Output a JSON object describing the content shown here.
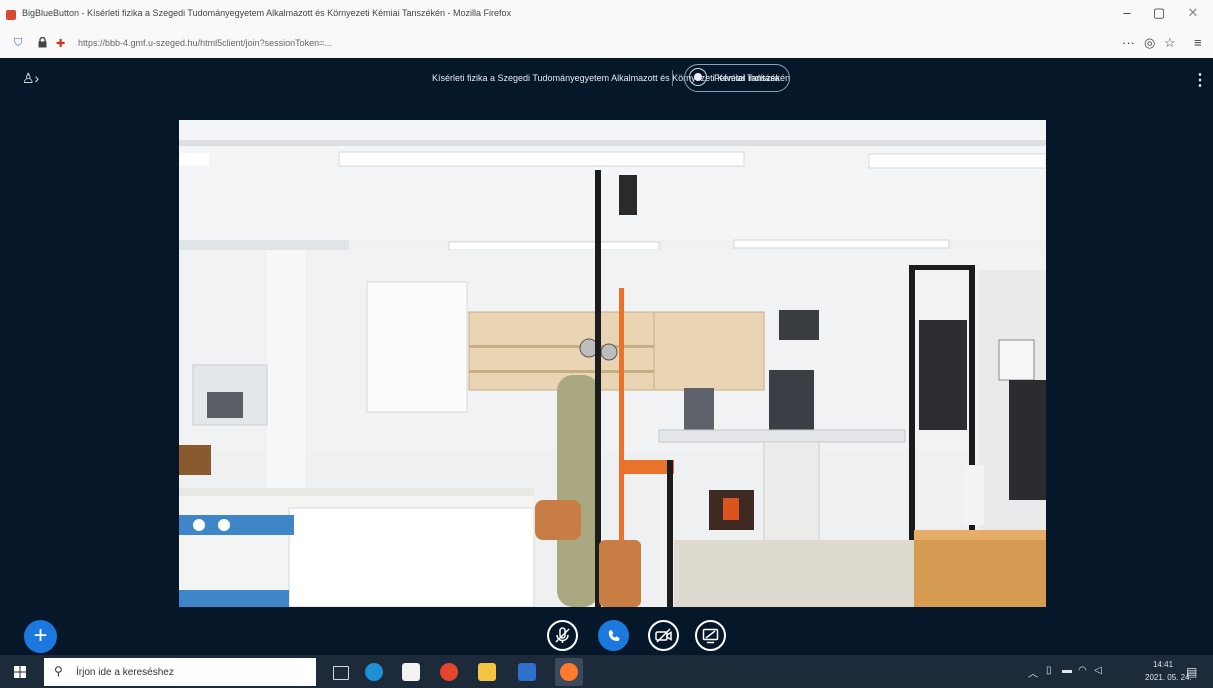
{
  "browser": {
    "window_title": "BigBlueButton - Kísérleti fizika a Szegedi Tudományegyetem Alkalmazott és Környezeti Kémiai Tanszékén - Mozilla Firefox",
    "url": "https://bbb-4.gmf.u-szeged.hu/html5client/join?sessionToken=...",
    "window_controls": {
      "minimize": "–",
      "restore": "▢",
      "close": "✕"
    },
    "nav_icons": [
      "shield-icon",
      "lock-icon",
      "site-permission-icon"
    ],
    "nav_right_icons": {
      "more": "···",
      "pocket": "◎",
      "bookmark": "☆",
      "menu": "≡"
    }
  },
  "meeting": {
    "title": "Kísérleti fizika a Szegedi Tudományegyetem Alkalmazott és Környezeti Kémiai Tanszékén",
    "recording_label": "Felvétel indítása",
    "options_glyph": "⋮",
    "users_glyph": "♙›"
  },
  "actions": {
    "add_glyph": "+"
  },
  "controls": [
    {
      "name": "mute-microphone",
      "icon": "microphone-off-icon",
      "active": false
    },
    {
      "name": "leave-audio",
      "icon": "phone-icon",
      "active": true
    },
    {
      "name": "share-webcam",
      "icon": "camera-off-icon",
      "active": false
    },
    {
      "name": "share-screen",
      "icon": "screen-share-icon",
      "active": false
    }
  ],
  "taskbar": {
    "search_placeholder": "Írjon ide a kereséshez",
    "apps": [
      "task-view-icon",
      "edge-icon",
      "store-icon",
      "chrome-icon",
      "file-explorer-icon",
      "word-icon",
      "firefox-icon"
    ],
    "clock": {
      "time": "14:41",
      "date": "2021. 05. 24."
    }
  },
  "colors": {
    "app_background": "#06172a",
    "accent": "#1b78de",
    "taskbar": "#1d2a3a"
  }
}
